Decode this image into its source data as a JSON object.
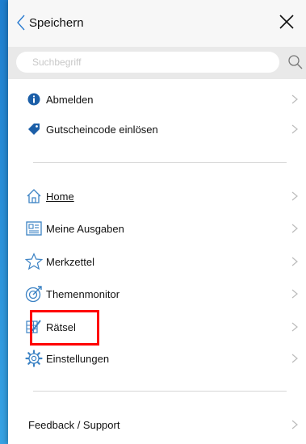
{
  "header": {
    "back_label": "Speichern"
  },
  "search": {
    "placeholder": "Suchbegriff"
  },
  "account": [
    {
      "label": "Abmelden",
      "icon": "info-icon"
    },
    {
      "label": "Gutscheincode einlösen",
      "icon": "tag-icon"
    }
  ],
  "nav": [
    {
      "label": "Home",
      "icon": "home-icon"
    },
    {
      "label": "Meine Ausgaben",
      "icon": "newspaper-icon"
    },
    {
      "label": "Merkzettel",
      "icon": "star-icon"
    },
    {
      "label": "Themenmonitor",
      "icon": "target-icon"
    },
    {
      "label": "Rätsel",
      "icon": "puzzle-pencil-icon"
    },
    {
      "label": "Einstellungen",
      "icon": "gear-icon"
    }
  ],
  "footer": {
    "feedback_label": "Feedback / Support"
  },
  "colors": {
    "accent": "#2a8fd8",
    "icon_blue": "#3b82c4",
    "highlight": "#ff0000"
  }
}
